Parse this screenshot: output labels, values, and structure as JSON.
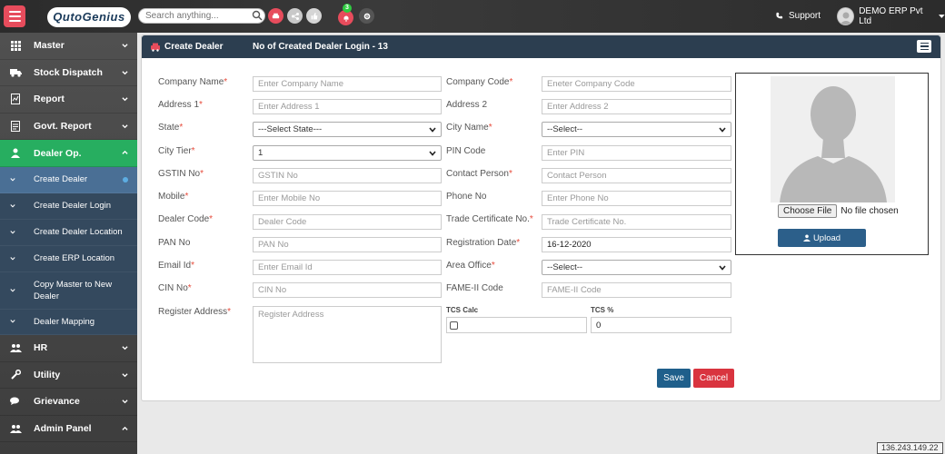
{
  "header": {
    "logo_text": "QutoGenius",
    "search_placeholder": "Search anything...",
    "notification_count": "3",
    "support_label": "Support",
    "user_name": "DEMO ERP Pvt Ltd"
  },
  "sidebar": {
    "items": [
      {
        "label": "Master",
        "icon": "grid-icon"
      },
      {
        "label": "Stock Dispatch",
        "icon": "truck-icon"
      },
      {
        "label": "Report",
        "icon": "report-icon"
      },
      {
        "label": "Govt. Report",
        "icon": "document-icon"
      },
      {
        "label": "Dealer Op.",
        "icon": "user-icon"
      },
      {
        "label": "HR",
        "icon": "users-icon"
      },
      {
        "label": "Utility",
        "icon": "wrench-icon"
      },
      {
        "label": "Grievance",
        "icon": "chat-icon"
      },
      {
        "label": "Admin Panel",
        "icon": "users-icon"
      }
    ],
    "sub_items": [
      "Create Dealer",
      "Create Dealer Login",
      "Create Dealer Location",
      "Create ERP Location",
      "Copy Master to New Dealer",
      "Dealer Mapping"
    ]
  },
  "panel": {
    "title": "Create Dealer",
    "count_label": "No of Created Dealer Login - 13"
  },
  "form": {
    "company_name": {
      "label": "Company Name",
      "placeholder": "Enter Company Name"
    },
    "company_code": {
      "label": "Company Code",
      "placeholder": "Eneter Company Code"
    },
    "address1": {
      "label": "Address 1",
      "placeholder": "Enter Address 1"
    },
    "address2": {
      "label": "Address 2",
      "placeholder": "Enter Address 2"
    },
    "state": {
      "label": "State",
      "value": "---Select State---"
    },
    "city_name": {
      "label": "City Name",
      "value": "--Select--"
    },
    "city_tier": {
      "label": "City Tier",
      "value": "1"
    },
    "pin_code": {
      "label": "PIN Code",
      "placeholder": "Enter PIN"
    },
    "gstin": {
      "label": "GSTIN No",
      "placeholder": "GSTIN No"
    },
    "contact_person": {
      "label": "Contact Person",
      "placeholder": "Contact Person"
    },
    "mobile": {
      "label": "Mobile",
      "placeholder": "Enter Mobile No"
    },
    "phone": {
      "label": "Phone No",
      "placeholder": "Enter Phone No"
    },
    "dealer_code": {
      "label": "Dealer Code",
      "placeholder": "Dealer Code"
    },
    "trade_cert": {
      "label": "Trade Certificate No.",
      "placeholder": "Trade Certificate No."
    },
    "pan": {
      "label": "PAN No",
      "placeholder": "PAN No"
    },
    "reg_date": {
      "label": "Registration Date",
      "value": "16-12-2020"
    },
    "email": {
      "label": "Email Id",
      "placeholder": "Enter Email Id"
    },
    "area_office": {
      "label": "Area Office",
      "value": "--Select--"
    },
    "cin": {
      "label": "CIN No",
      "placeholder": "CIN No"
    },
    "fame": {
      "label": "FAME-II Code",
      "placeholder": "FAME-II Code"
    },
    "register_address": {
      "label": "Register Address",
      "placeholder": "Register Address"
    },
    "tcs_calc_label": "TCS Calc",
    "tcs_pct": {
      "label": "TCS %",
      "value": "0"
    }
  },
  "upload": {
    "choose_label": "Choose File",
    "no_file_label": "No file chosen",
    "upload_label": "Upload"
  },
  "actions": {
    "save_label": "Save",
    "cancel_label": "Cancel"
  },
  "footer": {
    "ip": "136.243.149.22"
  },
  "colors": {
    "accent": "#2c3e50",
    "active_green": "#27ae60",
    "danger": "#d9343f",
    "primary": "#1f5f8b"
  }
}
